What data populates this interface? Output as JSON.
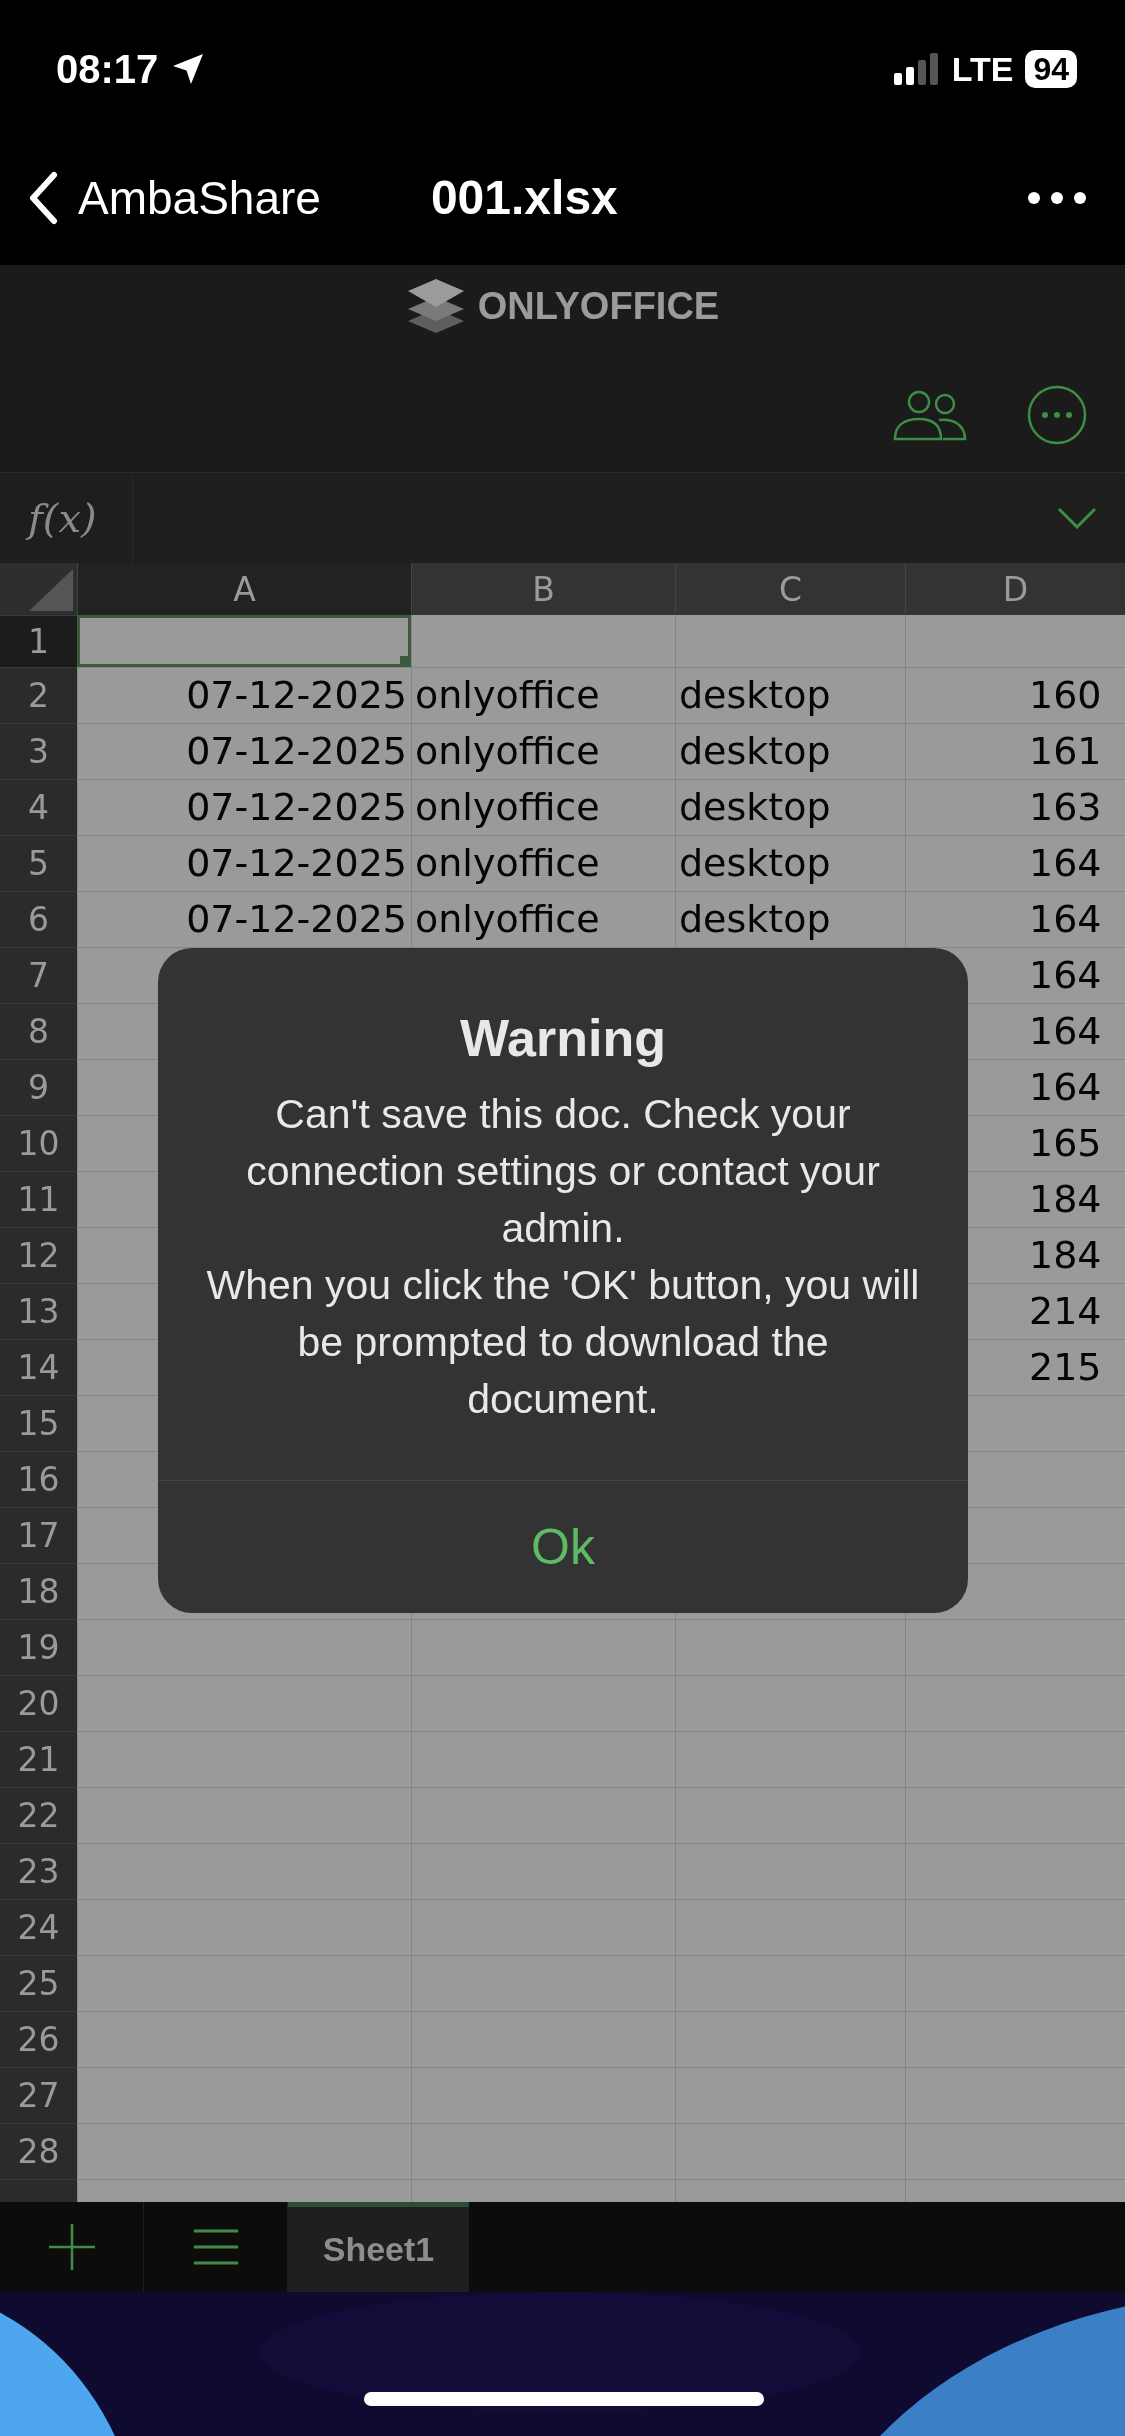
{
  "status_bar": {
    "time": "08:17",
    "network": "LTE",
    "battery": "94"
  },
  "nav_bar": {
    "back_label": "AmbaShare",
    "title": "001.xlsx"
  },
  "app_header": {
    "logo": "ONLYOFFICE"
  },
  "formula_bar": {
    "label": "f(x)"
  },
  "sheet": {
    "columns": [
      {
        "label": "A",
        "selected": true
      },
      {
        "label": "B",
        "selected": false
      },
      {
        "label": "C",
        "selected": false
      },
      {
        "label": "D",
        "selected": false
      }
    ],
    "rows": [
      {
        "label": "1",
        "selected": true,
        "cells": [
          null,
          null,
          null,
          null
        ]
      },
      {
        "label": "2",
        "selected": false,
        "cells": [
          "07-12-2025",
          "onlyoffice",
          "desktop",
          "160"
        ]
      },
      {
        "label": "3",
        "selected": false,
        "cells": [
          "07-12-2025",
          "onlyoffice",
          "desktop",
          "161"
        ]
      },
      {
        "label": "4",
        "selected": false,
        "cells": [
          "07-12-2025",
          "onlyoffice",
          "desktop",
          "163"
        ]
      },
      {
        "label": "5",
        "selected": false,
        "cells": [
          "07-12-2025",
          "onlyoffice",
          "desktop",
          "164"
        ]
      },
      {
        "label": "6",
        "selected": false,
        "cells": [
          "07-12-2025",
          "onlyoffice",
          "desktop",
          "164"
        ]
      },
      {
        "label": "7",
        "selected": false,
        "cells": [
          null,
          null,
          null,
          "164"
        ]
      },
      {
        "label": "8",
        "selected": false,
        "cells": [
          null,
          null,
          null,
          "164"
        ]
      },
      {
        "label": "9",
        "selected": false,
        "cells": [
          null,
          null,
          null,
          "164"
        ]
      },
      {
        "label": "10",
        "selected": false,
        "cells": [
          null,
          null,
          null,
          "165"
        ]
      },
      {
        "label": "11",
        "selected": false,
        "cells": [
          null,
          null,
          null,
          "184"
        ]
      },
      {
        "label": "12",
        "selected": false,
        "cells": [
          null,
          null,
          null,
          "184"
        ]
      },
      {
        "label": "13",
        "selected": false,
        "cells": [
          null,
          null,
          null,
          "214"
        ]
      },
      {
        "label": "14",
        "selected": false,
        "cells": [
          null,
          null,
          null,
          "215"
        ]
      },
      {
        "label": "15",
        "selected": false,
        "cells": [
          null,
          null,
          null,
          null
        ]
      },
      {
        "label": "16",
        "selected": false,
        "cells": [
          null,
          null,
          null,
          null
        ]
      },
      {
        "label": "17",
        "selected": false,
        "cells": [
          null,
          null,
          null,
          null
        ]
      },
      {
        "label": "18",
        "selected": false,
        "cells": [
          null,
          null,
          null,
          null
        ]
      },
      {
        "label": "19",
        "selected": false,
        "cells": [
          null,
          null,
          null,
          null
        ]
      },
      {
        "label": "20",
        "selected": false,
        "cells": [
          null,
          null,
          null,
          null
        ]
      },
      {
        "label": "21",
        "selected": false,
        "cells": [
          null,
          null,
          null,
          null
        ]
      },
      {
        "label": "22",
        "selected": false,
        "cells": [
          null,
          null,
          null,
          null
        ]
      },
      {
        "label": "23",
        "selected": false,
        "cells": [
          null,
          null,
          null,
          null
        ]
      },
      {
        "label": "24",
        "selected": false,
        "cells": [
          null,
          null,
          null,
          null
        ]
      },
      {
        "label": "25",
        "selected": false,
        "cells": [
          null,
          null,
          null,
          null
        ]
      },
      {
        "label": "26",
        "selected": false,
        "cells": [
          null,
          null,
          null,
          null
        ]
      },
      {
        "label": "27",
        "selected": false,
        "cells": [
          null,
          null,
          null,
          null
        ]
      },
      {
        "label": "28",
        "selected": false,
        "cells": [
          null,
          null,
          null,
          null
        ]
      }
    ]
  },
  "sheet_tabs": [
    {
      "label": "Sheet1",
      "selected": true
    }
  ],
  "dialog": {
    "title": "Warning",
    "message": [
      "Can't save this doc. Check your connection settings or contact your admin.",
      "When you click the 'OK' button, you will be prompted to download the document."
    ],
    "button": "Ok"
  }
}
